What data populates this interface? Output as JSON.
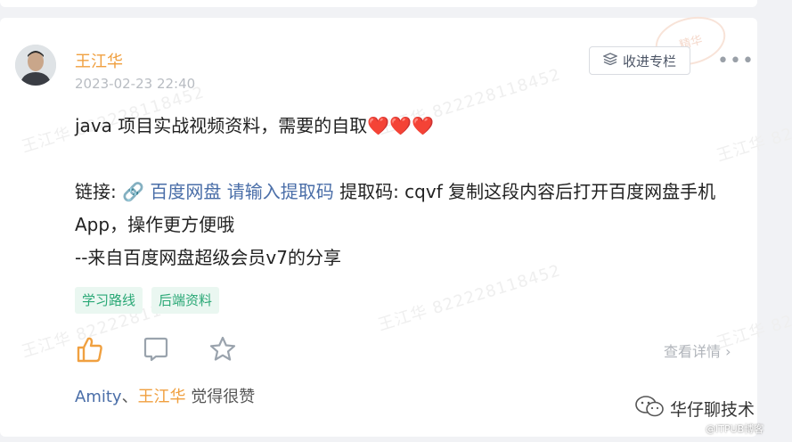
{
  "post": {
    "author": "王江华",
    "time": "2023-02-23 22:40",
    "collect_label": "收进专栏",
    "more": "•••",
    "stamp": "精华",
    "line1": "java 项目实战视频资料，需要的自取❤️❤️❤️",
    "link_prefix": "链接: ",
    "link_text": "🔗 百度网盘 请输入提取码",
    "line2_rest": " 提取码: cqvf 复制这段内容后打开百度网盘手机App，操作更方便哦",
    "line3": "--来自百度网盘超级会员v7的分享"
  },
  "tags": [
    "学习路线",
    "后端资料"
  ],
  "actions": {
    "detail_label": "查看详情 ›"
  },
  "likes": {
    "user1": "Amity",
    "sep": "、",
    "user2": "王江华",
    "suffix": " 觉得很赞"
  },
  "watermark_text": "王江华 822228118452",
  "wechat_name": "华仔聊技术",
  "itpub_label": "@ITPUB博客",
  "colors": {
    "author": "#f0a040",
    "link": "#4a6ea8",
    "tag_text": "#2aa876",
    "tag_bg": "#eaf7f1",
    "like_active": "#f0a040"
  }
}
